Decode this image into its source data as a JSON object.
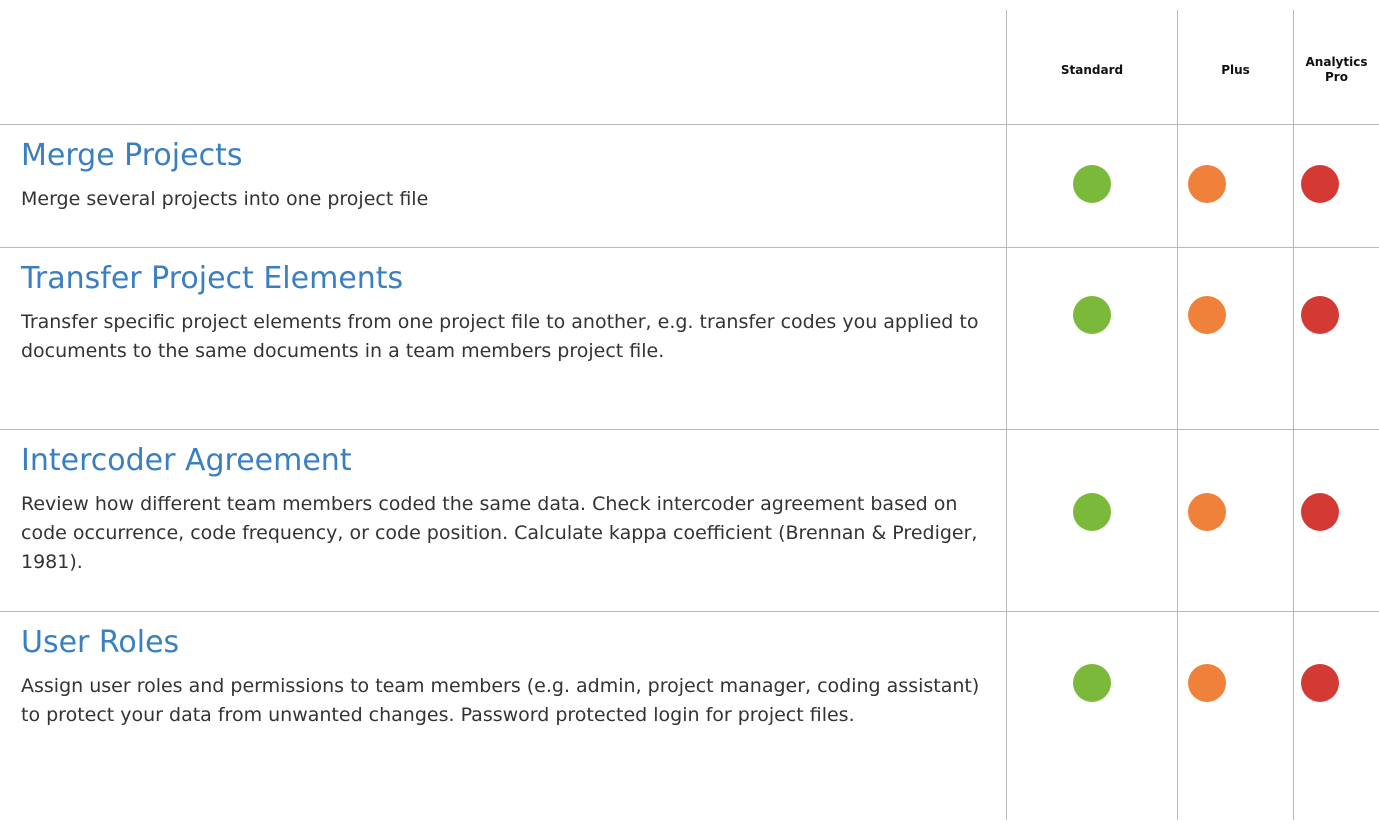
{
  "columns": [
    {
      "label": "Standard"
    },
    {
      "label": "Plus"
    },
    {
      "label": "Analytics\nPro"
    }
  ],
  "colors": {
    "standard": "#7ab93a",
    "plus": "#f0813a",
    "pro": "#d33a34",
    "title": "#3a7fc1"
  },
  "features": [
    {
      "title": "Merge Projects",
      "description": "Merge several projects into one project file",
      "standard": true,
      "plus": true,
      "pro": true
    },
    {
      "title": "Transfer Project Elements",
      "description": "Transfer specific project elements from one project file to another, e.g. transfer codes you applied to documents to the same documents in a team members project file.",
      "standard": true,
      "plus": true,
      "pro": true
    },
    {
      "title": "Intercoder Agreement",
      "description": "Review how different team members coded the same data. Check intercoder agreement based on code occurrence, code frequency, or code position. Calculate kappa coefficient (Brennan & Prediger, 1981).",
      "standard": true,
      "plus": true,
      "pro": true
    },
    {
      "title": "User Roles",
      "description": "Assign user roles and permissions to team members (e.g. admin, project manager, coding assistant) to protect your data from unwanted changes. Password protected login for project files.",
      "standard": true,
      "plus": true,
      "pro": true
    }
  ]
}
